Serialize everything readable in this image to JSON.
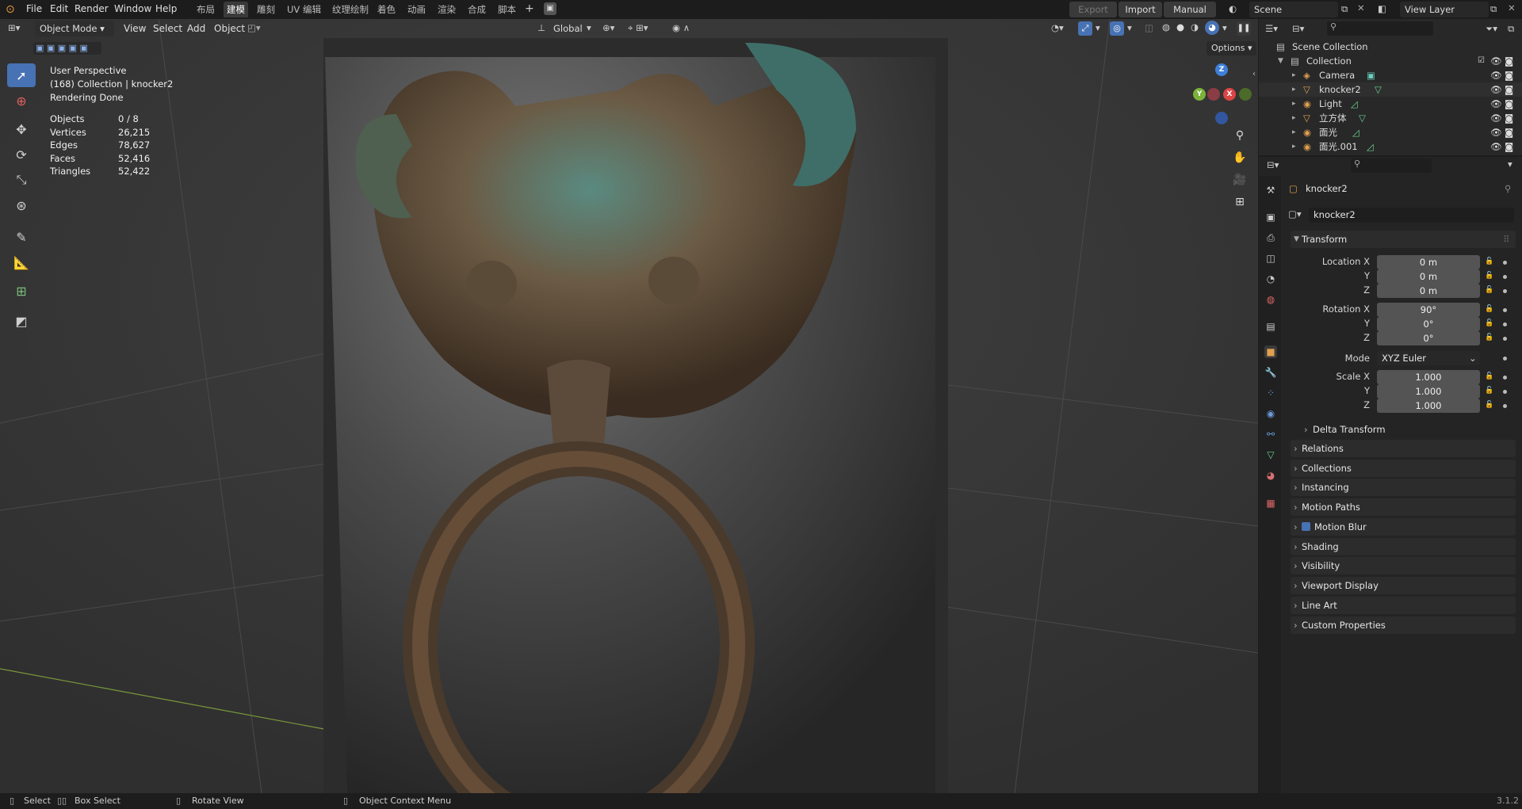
{
  "app": {
    "menus": [
      "File",
      "Edit",
      "Render",
      "Window",
      "Help"
    ],
    "workspaces": [
      "布局",
      "建模",
      "雕刻",
      "UV 编辑",
      "纹理绘制",
      "着色",
      "动画",
      "渲染",
      "合成",
      "脚本"
    ],
    "active_workspace": "建模",
    "export_label": "Export",
    "import_label": "Import",
    "manual_label": "Manual",
    "scene": "Scene",
    "view_layer": "View Layer",
    "version": "3.1.2"
  },
  "viewport": {
    "mode": "Object Mode",
    "menus": [
      "View",
      "Select",
      "Add",
      "Object"
    ],
    "orientation": "Global",
    "options_label": "Options",
    "info": [
      "User Perspective",
      "(168) Collection | knocker2",
      "Rendering Done"
    ],
    "stats": [
      {
        "k": "Objects",
        "v": "0 / 8"
      },
      {
        "k": "Vertices",
        "v": "26,215"
      },
      {
        "k": "Edges",
        "v": "78,627"
      },
      {
        "k": "Faces",
        "v": "52,416"
      },
      {
        "k": "Triangles",
        "v": "52,422"
      }
    ],
    "gizmo": {
      "z": "Z",
      "y": "Y",
      "x": "X"
    }
  },
  "outliner": {
    "root": "Scene Collection",
    "collection": "Collection",
    "items": [
      "Camera",
      "knocker2",
      "Light",
      "立方体",
      "面光",
      "面光.001"
    ]
  },
  "properties": {
    "object_name": "knocker2",
    "data_name": "knocker2",
    "transform_label": "Transform",
    "location": {
      "label": "Location X",
      "x": "0 m",
      "y": "0 m",
      "z": "0 m"
    },
    "rotation": {
      "label": "Rotation X",
      "x": "90°",
      "y": "0°",
      "z": "0°"
    },
    "mode_label": "Mode",
    "mode_value": "XYZ Euler",
    "scale": {
      "label": "Scale X",
      "x": "1.000",
      "y": "1.000",
      "z": "1.000"
    },
    "axis_y": "Y",
    "axis_z": "Z",
    "delta": "Delta Transform",
    "sections": [
      "Relations",
      "Collections",
      "Instancing",
      "Motion Paths",
      "Motion Blur",
      "Shading",
      "Visibility",
      "Viewport Display",
      "Line Art",
      "Custom Properties"
    ]
  },
  "status": {
    "select": "Select",
    "box_select": "Box Select",
    "rotate_view": "Rotate View",
    "context_menu": "Object Context Menu"
  }
}
